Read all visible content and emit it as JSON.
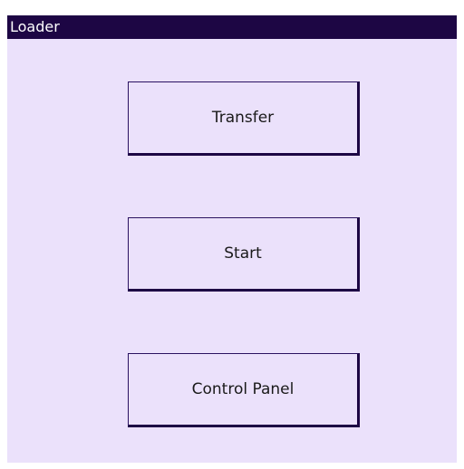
{
  "window": {
    "title": "Loader"
  },
  "buttons": {
    "transfer": "Transfer",
    "start": "Start",
    "control_panel": "Control Panel"
  },
  "colors": {
    "titlebar": "#1d0644",
    "window_bg": "#ebe1fb",
    "button_shadow": "#1d0644"
  }
}
